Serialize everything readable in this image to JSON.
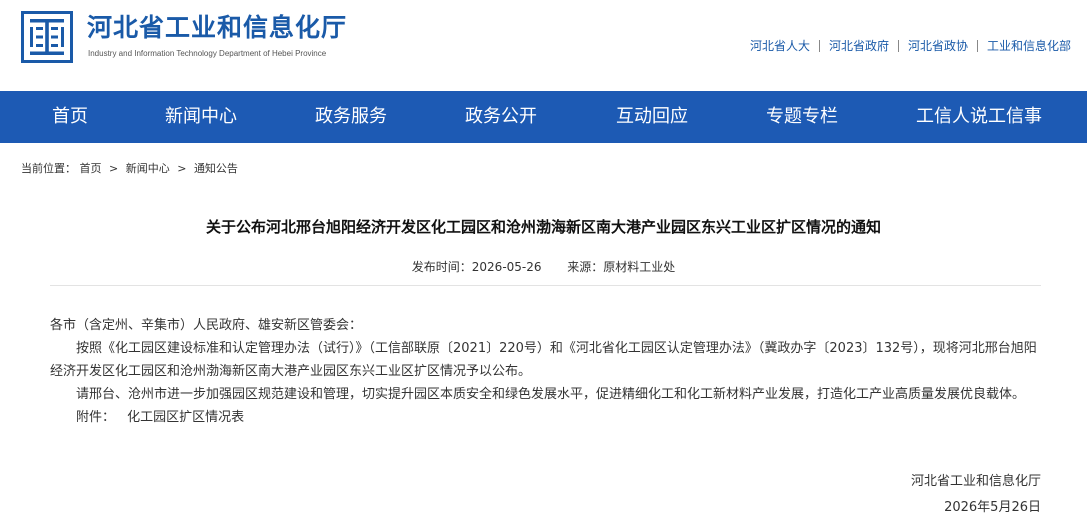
{
  "header": {
    "title": "河北省工业和信息化厅",
    "subtitle": "Industry and Information Technology Department of Hebei Province",
    "logo_color": "#1a5aa8",
    "top_links": [
      "河北省人大",
      "河北省政府",
      "河北省政协",
      "工业和信息化部"
    ]
  },
  "nav": {
    "bg_color": "#1d5ab4",
    "items": [
      "首页",
      "新闻中心",
      "政务服务",
      "政务公开",
      "互动回应",
      "专题专栏",
      "工信人说工信事"
    ]
  },
  "breadcrumb": {
    "label": "当前位置：",
    "items": [
      "首页",
      "新闻中心",
      "通知公告"
    ],
    "separator": ">"
  },
  "article": {
    "title": "关于公布河北邢台旭阳经济开发区化工园区和沧州渤海新区南大港产业园区东兴工业区扩区情况的通知",
    "date_label": "发布时间：",
    "date": "2026-05-26",
    "source_label": "来源：",
    "source": "原材料工业处",
    "salutation": "各市（含定州、辛集市）人民政府、雄安新区管委会：",
    "paragraphs": [
      "按照《化工园区建设标准和认定管理办法（试行）》（工信部联原〔2021〕220号）和《河北省化工园区认定管理办法》（冀政办字〔2023〕132号），现将河北邢台旭阳经济开发区化工园区和沧州渤海新区南大港产业园区东兴工业区扩区情况予以公布。",
      "请邢台、沧州市进一步加强园区规范建设和管理，切实提升园区本质安全和绿色发展水平，促进精细化工和化工新材料产业发展，打造化工产业高质量发展优良载体。"
    ],
    "attachment_label": "附件：",
    "attachment": "化工园区扩区情况表",
    "signature": "河北省工业和信息化厅",
    "sign_date": "2026年5月26日"
  }
}
